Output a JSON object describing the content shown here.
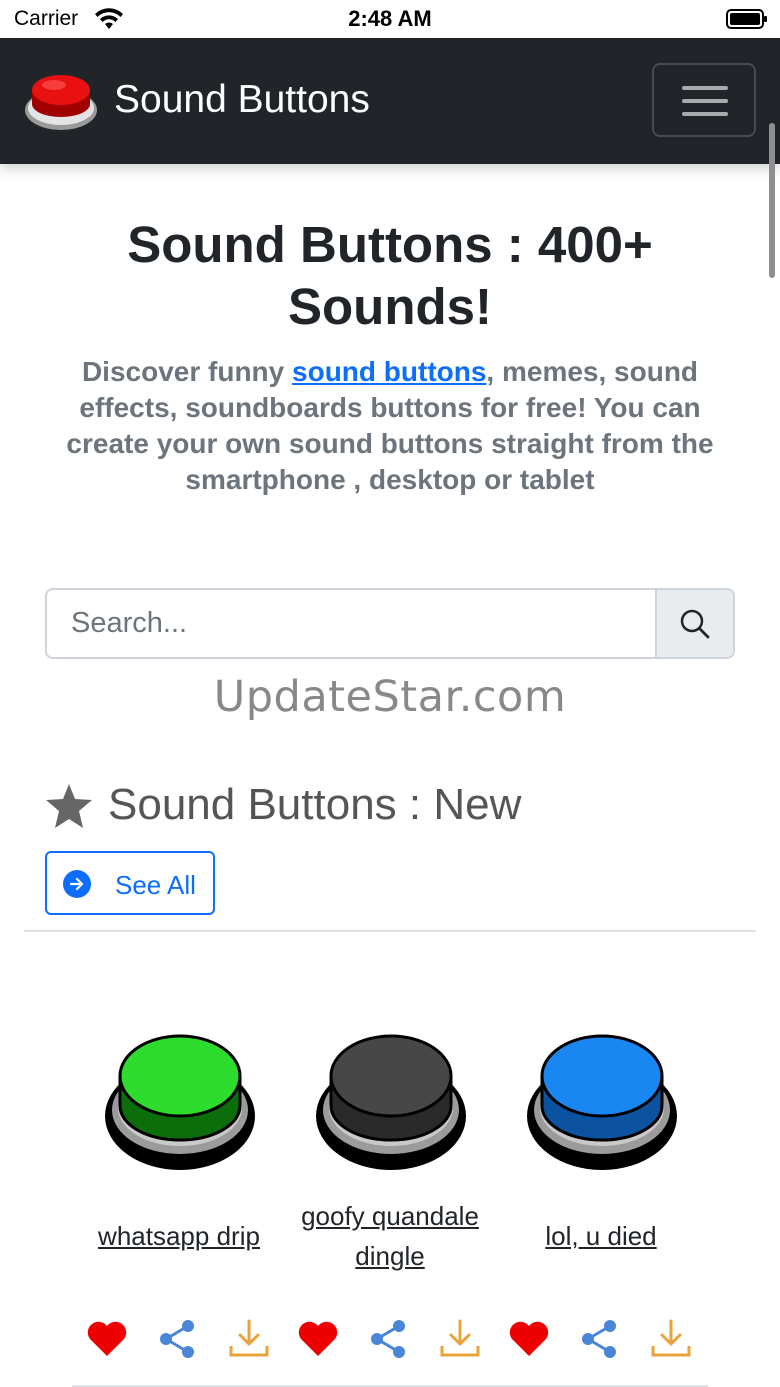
{
  "status_bar": {
    "carrier": "Carrier",
    "time": "2:48 AM"
  },
  "navbar": {
    "brand": "Sound Buttons"
  },
  "hero": {
    "title": "Sound Buttons : 400+ Sounds!",
    "desc_before": "Discover funny ",
    "desc_link": "sound buttons",
    "desc_after": ", memes, sound effects, soundboards buttons for free! You can create your own sound buttons straight from the smartphone , desktop or tablet"
  },
  "search": {
    "placeholder": "Search...",
    "value": ""
  },
  "watermark": "UpdateStar.com",
  "section": {
    "title": "Sound Buttons : New",
    "see_all": "See All"
  },
  "sounds": [
    {
      "name": "whatsapp drip",
      "color": "#2ddc2d",
      "dark": "#0b6e0b"
    },
    {
      "name": "goofy quandale dingle",
      "color": "#474747",
      "dark": "#2a2a2a"
    },
    {
      "name": "lol, u died",
      "color": "#1a86f2",
      "dark": "#0b52a0"
    }
  ],
  "colors": {
    "heart": "#ee0000",
    "share": "#4a86d8",
    "download": "#e8a33a",
    "accent": "#0d6efd"
  }
}
